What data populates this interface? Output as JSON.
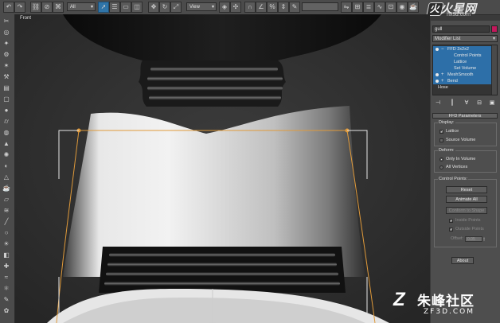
{
  "toolbar": {
    "selection_filter": "All",
    "reference_coord": "View",
    "icons": [
      "undo-icon",
      "redo-icon",
      "link-icon",
      "unlink-icon",
      "bind-icon",
      "filter-icon",
      "select-arrow-icon",
      "select-by-name-icon",
      "rect-selection-icon",
      "window-crossing-icon",
      "move-icon",
      "rotate-icon",
      "scale-icon",
      "pivot-icon",
      "select-manipulate-icon",
      "keyboard-shortcut-icon",
      "snap-icon",
      "angle-snap-icon",
      "percent-snap-icon",
      "spinner-snap-icon",
      "named-selection-icon",
      "mirror-icon",
      "align-icon",
      "layer-icon",
      "curve-editor-icon",
      "schematic-icon",
      "material-editor-icon",
      "render-setup-icon",
      "render-icon"
    ]
  },
  "logo": {
    "mark": "火",
    "name": "火星网",
    "url": "hxsd.com"
  },
  "viewport": {
    "label": "Front"
  },
  "panel": {
    "object_name": "gull",
    "object_color": "#c2185b",
    "modifier_list": "Modifier List",
    "stack": [
      {
        "label": "FFD 2x2x2",
        "level": 0,
        "selected": true,
        "expand": "−"
      },
      {
        "label": "Control Points",
        "level": 1,
        "selected": true
      },
      {
        "label": "Lattice",
        "level": 1,
        "selected": true
      },
      {
        "label": "Set Volume",
        "level": 1,
        "selected": true
      },
      {
        "label": "MeshSmooth",
        "level": 0,
        "selected": true,
        "expand": "+"
      },
      {
        "label": "Bend",
        "level": 0,
        "selected": true,
        "expand": "+"
      },
      {
        "label": "Hose",
        "level": 0,
        "selected": false
      }
    ],
    "rollout_title": "FFD Parameters",
    "display": {
      "title": "Display:",
      "lattice": {
        "label": "Lattice",
        "checked": true
      },
      "source_volume": {
        "label": "Source Volume",
        "checked": false
      }
    },
    "deform": {
      "title": "Deform:",
      "only_in_volume": {
        "label": "Only In Volume",
        "selected": true
      },
      "all_vertices": {
        "label": "All Vertices",
        "selected": false
      }
    },
    "control_points": {
      "title": "Control Points:",
      "reset": "Reset",
      "animate_all": "Animate All",
      "conform": "Conform to Shape",
      "inside_points": "Inside Points",
      "outside_points": "Outside Points",
      "offset_label": "Offset:",
      "offset_value": "0.05"
    },
    "about": "About"
  },
  "watermark": {
    "mark": "Z",
    "name": "朱峰社区",
    "url": "ZF3D.COM"
  }
}
